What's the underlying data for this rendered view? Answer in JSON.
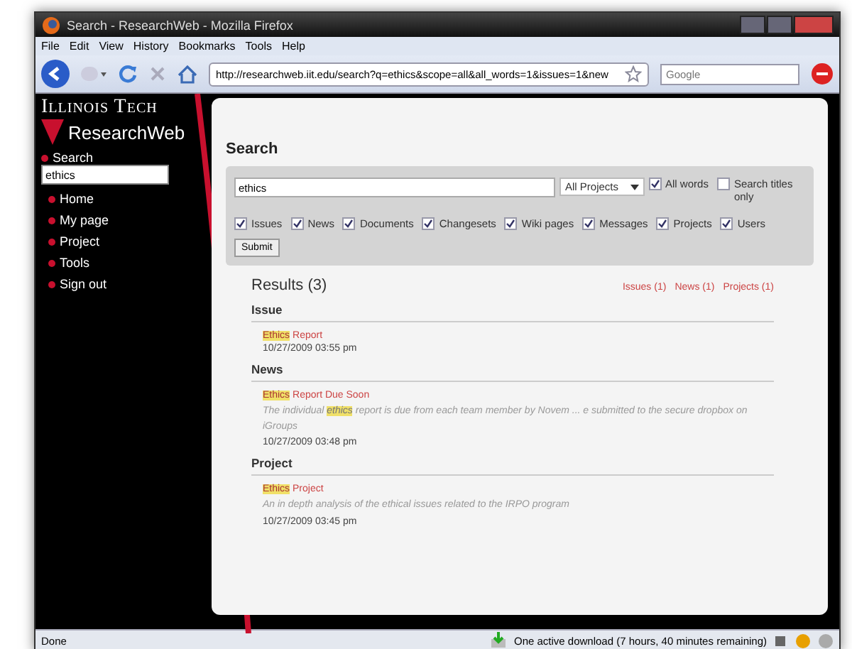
{
  "window": {
    "title": "Search - ResearchWeb - Mozilla Firefox"
  },
  "menu": [
    "File",
    "Edit",
    "View",
    "History",
    "Bookmarks",
    "Tools",
    "Help"
  ],
  "address": "http://researchweb.iit.edu/search?q=ethics&scope=all&all_words=1&issues=1&new",
  "web_search": {
    "placeholder": "Google"
  },
  "logo": {
    "line1": "Illinois Tech",
    "line2": "ResearchWeb"
  },
  "sidebar": {
    "search_label": "Search",
    "search_value": "ethics",
    "items": [
      "Home",
      "My page",
      "Project",
      "Tools",
      "Sign out"
    ]
  },
  "page_title": "Search",
  "form": {
    "query": "ethics",
    "scope": "All Projects",
    "options": [
      {
        "label": "All words",
        "checked": true
      },
      {
        "label": "Search titles only",
        "checked": false
      }
    ],
    "types": [
      {
        "label": "Issues",
        "checked": true
      },
      {
        "label": "News",
        "checked": true
      },
      {
        "label": "Documents",
        "checked": true
      },
      {
        "label": "Changesets",
        "checked": true
      },
      {
        "label": "Wiki pages",
        "checked": true
      },
      {
        "label": "Messages",
        "checked": true
      },
      {
        "label": "Projects",
        "checked": true
      },
      {
        "label": "Users",
        "checked": true
      }
    ],
    "submit": "Submit"
  },
  "results_title": "Results (3)",
  "filters": [
    "Issues (1)",
    "News (1)",
    "Projects (1)"
  ],
  "groups": [
    {
      "heading": "Issue",
      "items": [
        {
          "title_match": "Ethics",
          "title_rest": "Report",
          "date": "10/27/2009 03:55 pm"
        }
      ]
    },
    {
      "heading": "News",
      "items": [
        {
          "title_match": "Ethics",
          "title_rest": "Report Due Soon",
          "description": [
            {
              "text": "The individual ",
              "match": false
            },
            {
              "text": "ethics",
              "match": true
            },
            {
              "text": " report is due from each team member by Novem ... e submitted to the secure dropbox on iGroups",
              "match": false
            }
          ],
          "date": "10/27/2009 03:48 pm"
        }
      ]
    },
    {
      "heading": "Project",
      "items": [
        {
          "title_match": "Ethics",
          "title_rest": "Project",
          "description": [
            {
              "text": "An in depth analysis of the ethical issues related to the IRPO program",
              "match": false
            }
          ],
          "date": "10/27/2009 03:45 pm"
        }
      ]
    }
  ],
  "status_bar": {
    "left": "Done",
    "download": "One active download (7 hours, 40 minutes remaining)"
  }
}
